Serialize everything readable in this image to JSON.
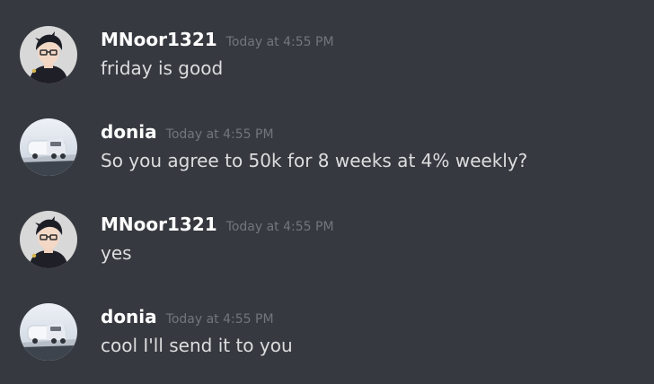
{
  "messages": [
    {
      "author": "MNoor1321",
      "timestamp": "Today at 4:55 PM",
      "content": "friday is good",
      "avatar": "anime-avatar"
    },
    {
      "author": "donia",
      "timestamp": "Today at 4:55 PM",
      "content": "So you agree to 50k for 8 weeks at 4% weekly?",
      "avatar": "truck-avatar"
    },
    {
      "author": "MNoor1321",
      "timestamp": "Today at 4:55 PM",
      "content": "yes",
      "avatar": "anime-avatar"
    },
    {
      "author": "donia",
      "timestamp": "Today at 4:55 PM",
      "content": "cool I'll send it to you",
      "avatar": "truck-avatar"
    }
  ],
  "colors": {
    "background": "#36393f",
    "username": "#ffffff",
    "timestamp": "#72767d",
    "message_text": "#dcddde"
  }
}
